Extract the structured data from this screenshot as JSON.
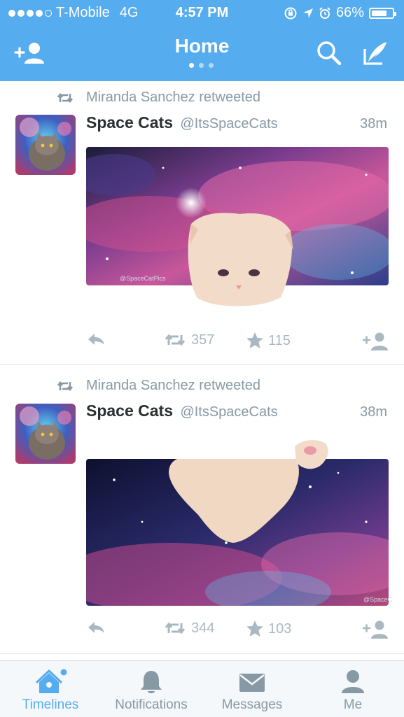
{
  "status_bar": {
    "carrier": "T-Mobile",
    "network": "4G",
    "time": "4:57 PM",
    "battery": "66%",
    "signal_bars": 4
  },
  "nav": {
    "title": "Home",
    "page_count": 3,
    "active_page": 1
  },
  "tweets": [
    {
      "retweeted_by": "Miranda Sanchez retweeted",
      "name": "Space Cats",
      "handle": "@ItsSpaceCats",
      "time": "38m",
      "image_caption": "@SpaceCatPics",
      "retweets": "357",
      "favorites": "115"
    },
    {
      "retweeted_by": "Miranda Sanchez retweeted",
      "name": "Space Cats",
      "handle": "@ItsSpaceCats",
      "time": "38m",
      "image_caption": "@SpaceC",
      "retweets": "344",
      "favorites": "103"
    }
  ],
  "tabs": [
    {
      "label": "Timelines",
      "icon": "home-icon",
      "active": true,
      "badge": true
    },
    {
      "label": "Notifications",
      "icon": "bell-icon",
      "active": false
    },
    {
      "label": "Messages",
      "icon": "envelope-icon",
      "active": false
    },
    {
      "label": "Me",
      "icon": "person-icon",
      "active": false
    }
  ],
  "colors": {
    "brand": "#55acee",
    "text": "#292f33",
    "muted": "#8899a6",
    "icon_muted": "#aab8c2"
  }
}
